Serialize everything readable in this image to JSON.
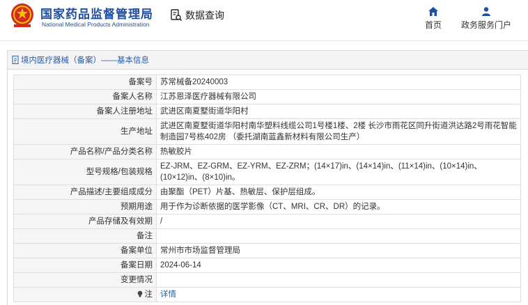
{
  "header": {
    "brand_cn": "国家药品监督管理局",
    "brand_en": "National Medical Products Administration",
    "query_label": "数据查询",
    "nav": {
      "home": "首页",
      "gov_portal": "政务服务门户"
    },
    "accent_color": "#1f4fa0"
  },
  "panel": {
    "title": "境内医疗器械（备案）——基本信息"
  },
  "record": {
    "rows": [
      {
        "label": "备案号",
        "value": "苏常械备20240003"
      },
      {
        "label": "备案人名称",
        "value": "江苏恩泽医疗器械有限公司"
      },
      {
        "label": "备案人注册地址",
        "value": "武进区南夏墅街道华阳村"
      },
      {
        "label": "生产地址",
        "value": "武进区南夏墅街道华阳村南华塑料线缆公司1号楼1楼、2楼 长沙市雨花区同升街道洪达路2号雨花智能制造园7号栋402房 （委托湖南蓝鑫新材料有限公司生产）"
      },
      {
        "label": "产品名称/产品分类名称",
        "value": "热敏胶片"
      },
      {
        "label": "型号规格/包装规格",
        "value": "EZ-JRM、EZ-GRM、EZ-YRM、EZ-ZRM；(14×17)in、(14×14)in、(11×14)in、(10×14)in、(10×12)in、(8×10)in。"
      },
      {
        "label": "产品描述/主要组成成分",
        "value": "由聚酯（PET）片基、热敏层、保护层组成。"
      },
      {
        "label": "预期用途",
        "value": "用于作为诊断依据的医学影像（CT、MRI、CR、DR）的记录。"
      },
      {
        "label": "产品存储及有效期",
        "value": "/"
      },
      {
        "label": "备注",
        "value": ""
      },
      {
        "label": "备案单位",
        "value": "常州市市场监督管理局"
      },
      {
        "label": "备案日期",
        "value": "2024-06-14"
      },
      {
        "label": "变更情况",
        "value": ""
      },
      {
        "label": "注",
        "value": "详情"
      }
    ]
  }
}
